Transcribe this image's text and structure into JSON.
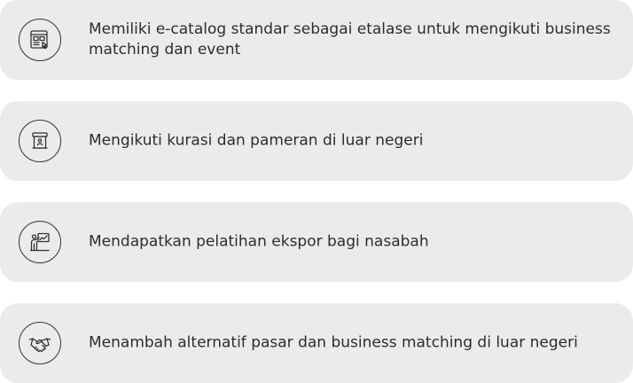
{
  "benefits": [
    {
      "icon": "ecatalog-storefront-icon",
      "text": "Memiliki e-catalog standar sebagai etalase untuk mengikuti business matching dan event"
    },
    {
      "icon": "exhibition-booth-icon",
      "text": "Mengikuti kurasi dan pameran di luar negeri"
    },
    {
      "icon": "training-presentation-icon",
      "text": "Mendapatkan pelatihan ekspor bagi nasabah"
    },
    {
      "icon": "handshake-icon",
      "text": "Menambah alternatif pasar dan business matching di luar negeri"
    }
  ],
  "colors": {
    "card_background": "#ebebeb",
    "text": "#2d2d2d",
    "icon_stroke": "#333333"
  }
}
